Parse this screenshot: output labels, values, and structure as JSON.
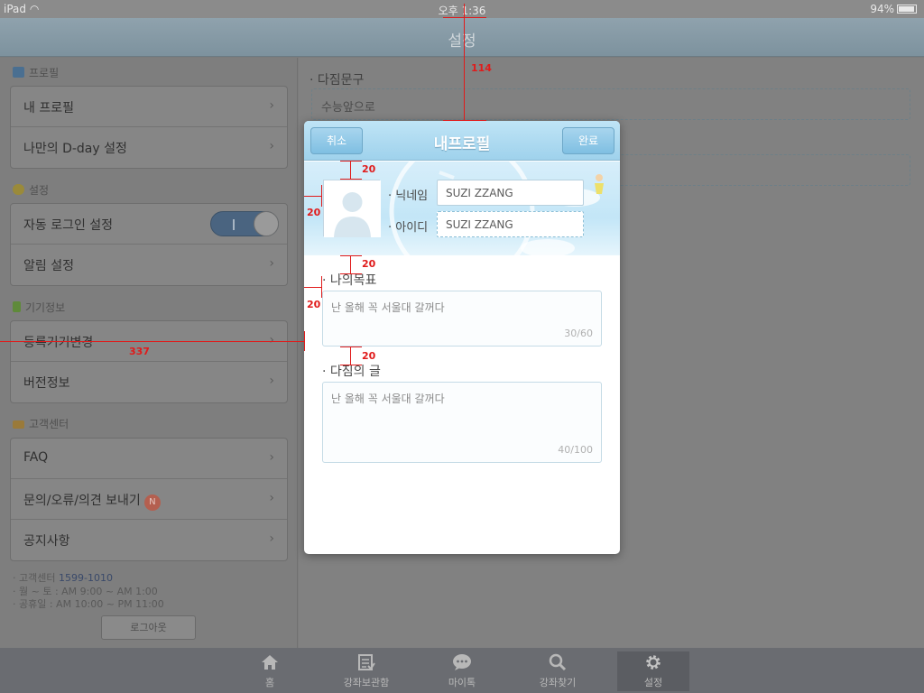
{
  "status": {
    "device": "iPad",
    "time": "오후 1:36",
    "battery": "94%"
  },
  "nav": {
    "title": "설정"
  },
  "left": {
    "profile_header": "프로필",
    "profile_items": [
      "내 프로필",
      "나만의 D-day 설정"
    ],
    "settings_header": "설정",
    "settings_items": [
      "자동 로그인 설정",
      "알림 설정"
    ],
    "device_header": "기기정보",
    "device_items": [
      "등록기기변경",
      "버전정보"
    ],
    "cs_header": "고객센터",
    "cs_items": [
      "FAQ",
      "문의/오류/의견 보내기",
      "공지사항"
    ],
    "cs_badge": "N",
    "info_line1_label": "· 고객센터",
    "info_line1_value": "1599-1010",
    "info_line2": "· 월 ~ 토 : AM 9:00 ~ AM 1:00",
    "info_line3": "· 공휴일 : AM 10:00 ~ PM 11:00",
    "logout": "로그아웃"
  },
  "right": {
    "motto_label": "· 다짐문구",
    "motto_value": "수능앞으로"
  },
  "tabs": [
    "홈",
    "강좌보관함",
    "마이톡",
    "강좌찾기",
    "설정"
  ],
  "modal": {
    "title": "내프로필",
    "cancel": "취소",
    "done": "완료",
    "nickname_label": "· 닉네임",
    "nickname_value": "SUZI ZZANG",
    "id_label": "· 아이디",
    "id_value": "SUZI ZZANG",
    "goal_label": "· 나의목표",
    "goal_placeholder": "난 올해 꼭 서울대 갈꺼다",
    "goal_count": "30/60",
    "pledge_label": "· 다짐의 글",
    "pledge_placeholder": "난 올해 꼭 서울대 갈꺼다",
    "pledge_count": "40/100"
  },
  "annotations": {
    "top_gap": "114",
    "left_gap": "337",
    "spacing": "20"
  },
  "colors": {
    "accent": "#9fd2ec",
    "annotation": "#e01b1b"
  }
}
